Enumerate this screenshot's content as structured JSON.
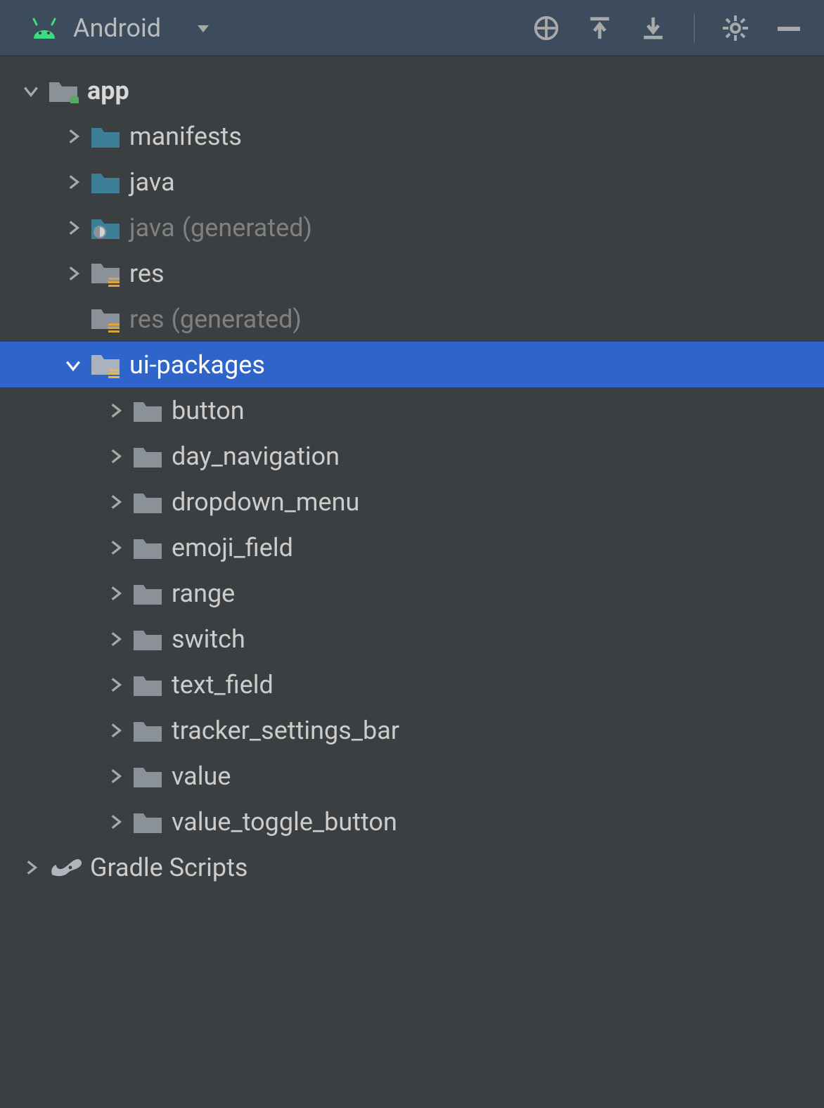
{
  "header": {
    "view_title": "Android"
  },
  "tree": {
    "root": {
      "label": "app",
      "children": [
        {
          "label": "manifests",
          "folder_color": "teal",
          "has_chevron": true
        },
        {
          "label": "java",
          "folder_color": "teal",
          "has_chevron": true
        },
        {
          "label": "java",
          "suffix": "(generated)",
          "folder_color": "teal-swirl",
          "has_chevron": true
        },
        {
          "label": "res",
          "folder_color": "grey-layered",
          "has_chevron": true
        },
        {
          "label": "res",
          "suffix": "(generated)",
          "folder_color": "grey-layered",
          "has_chevron": false
        },
        {
          "label": "ui-packages",
          "folder_color": "grey-layered",
          "expanded": true,
          "selected": true,
          "children": [
            {
              "label": "button"
            },
            {
              "label": "day_navigation"
            },
            {
              "label": "dropdown_menu"
            },
            {
              "label": "emoji_field"
            },
            {
              "label": "range"
            },
            {
              "label": "switch"
            },
            {
              "label": "text_field"
            },
            {
              "label": "tracker_settings_bar"
            },
            {
              "label": "value"
            },
            {
              "label": "value_toggle_button"
            }
          ]
        }
      ]
    },
    "gradle": {
      "label": "Gradle Scripts"
    }
  }
}
